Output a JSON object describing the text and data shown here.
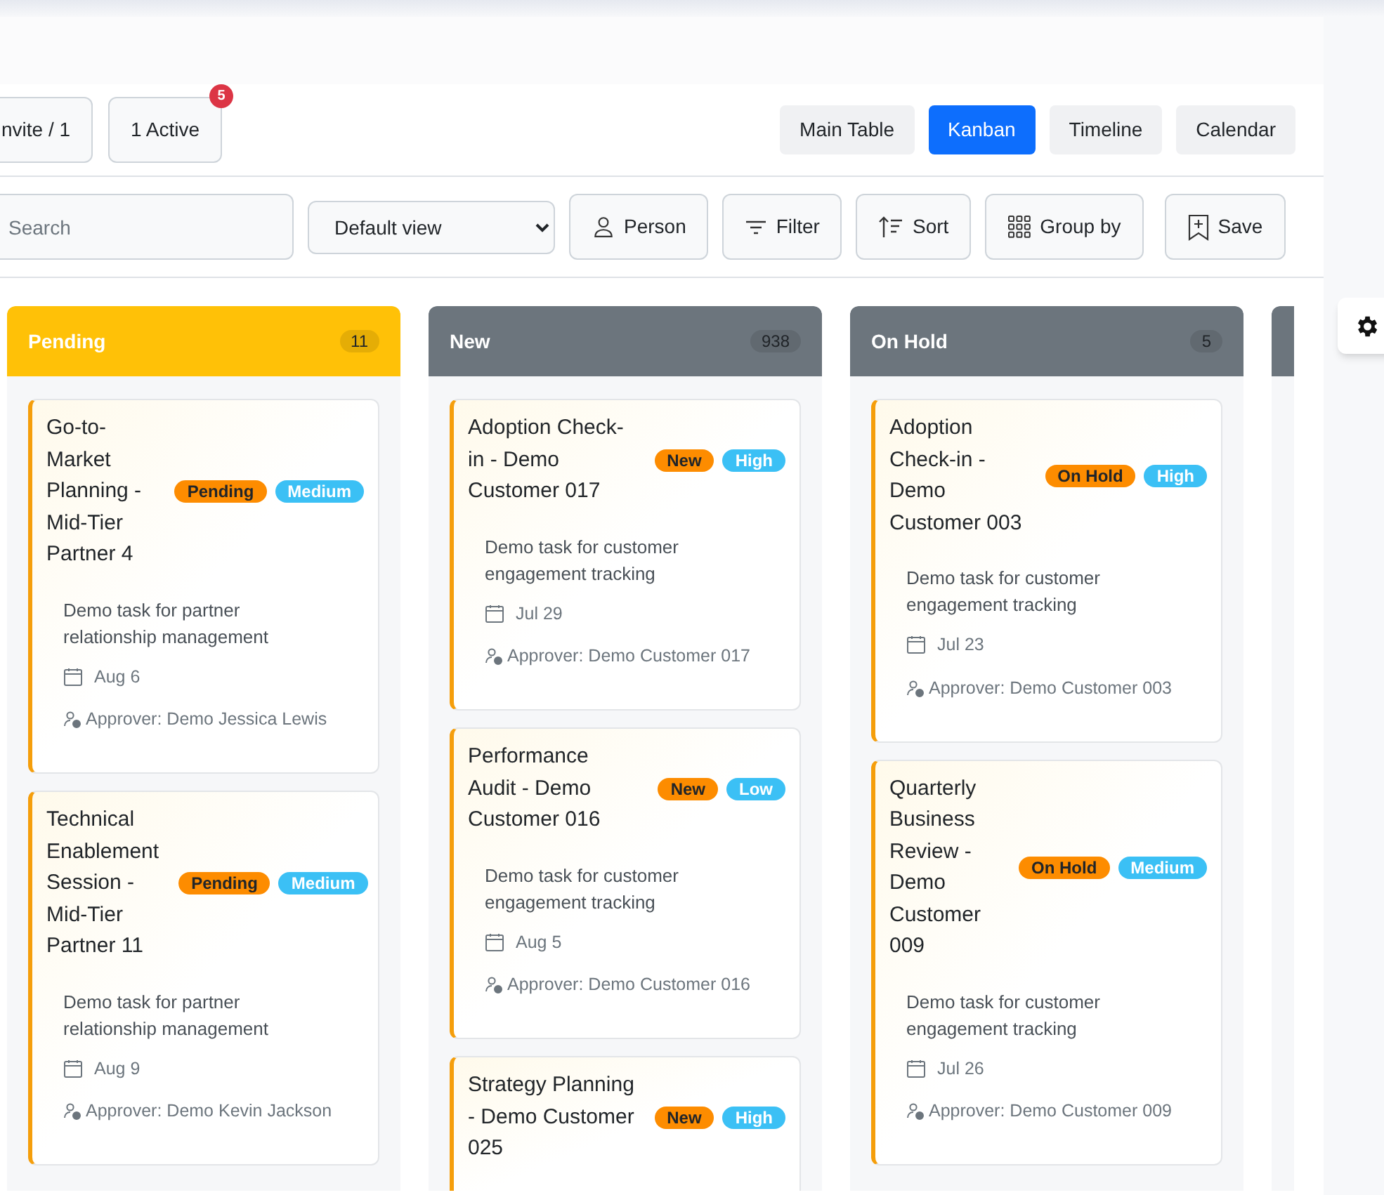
{
  "top_buttons": [
    {
      "label": "nvite / 1"
    },
    {
      "label": "1 Active",
      "badge": "5"
    }
  ],
  "view_tabs": [
    {
      "label": "Main Table",
      "selected": false
    },
    {
      "label": "Kanban",
      "selected": true
    },
    {
      "label": "Timeline",
      "selected": false
    },
    {
      "label": "Calendar",
      "selected": false
    }
  ],
  "search": {
    "placeholder": "Search"
  },
  "view_select": {
    "value": "Default view"
  },
  "tool_buttons": [
    {
      "kind": "person",
      "label": "Person"
    },
    {
      "kind": "filter",
      "label": "Filter"
    },
    {
      "kind": "sort",
      "label": "Sort"
    },
    {
      "kind": "group",
      "label": "Group by"
    },
    {
      "kind": "save",
      "label": "Save"
    }
  ],
  "columns": [
    {
      "name": "Pending",
      "count": "11",
      "color": "#ffc107",
      "cards": [
        {
          "title": "Go-to-Market Planning - Mid-Tier Partner 4",
          "status": "Pending",
          "priority": "Medium",
          "description": "Demo task for partner relationship management",
          "date": "Aug 6",
          "approver": "Approver: Demo Jessica Lewis"
        },
        {
          "title": "Technical Enablement Session - Mid-Tier Partner 11",
          "status": "Pending",
          "priority": "Medium",
          "description": "Demo task for partner relationship management",
          "date": "Aug 9",
          "approver": "Approver: Demo Kevin Jackson"
        }
      ]
    },
    {
      "name": "New",
      "count": "938",
      "color": "#6c757d",
      "cards": [
        {
          "title": "Adoption Check-in - Demo Customer 017",
          "status": "New",
          "priority": "High",
          "description": "Demo task for customer engagement tracking",
          "date": "Jul 29",
          "approver": "Approver: Demo Customer 017"
        },
        {
          "title": "Performance Audit - Demo Customer 016",
          "status": "New",
          "priority": "Low",
          "description": "Demo task for customer engagement tracking",
          "date": "Aug 5",
          "approver": "Approver: Demo Customer 016"
        },
        {
          "title": "Strategy Planning - Demo Customer 025",
          "status": "New",
          "priority": "High"
        }
      ]
    },
    {
      "name": "On Hold",
      "count": "5",
      "color": "#6c757d",
      "cards": [
        {
          "title": "Adoption Check-in - Demo Customer 003",
          "status": "On Hold",
          "priority": "High",
          "description": "Demo task for customer engagement tracking",
          "date": "Jul 23",
          "approver": "Approver: Demo Customer 003"
        },
        {
          "title": "Quarterly Business Review - Demo Customer 009",
          "status": "On Hold",
          "priority": "Medium",
          "description": "Demo task for customer engagement tracking",
          "date": "Jul 26",
          "approver": "Approver: Demo Customer 009"
        }
      ]
    },
    {
      "color": "#6c757d"
    }
  ]
}
